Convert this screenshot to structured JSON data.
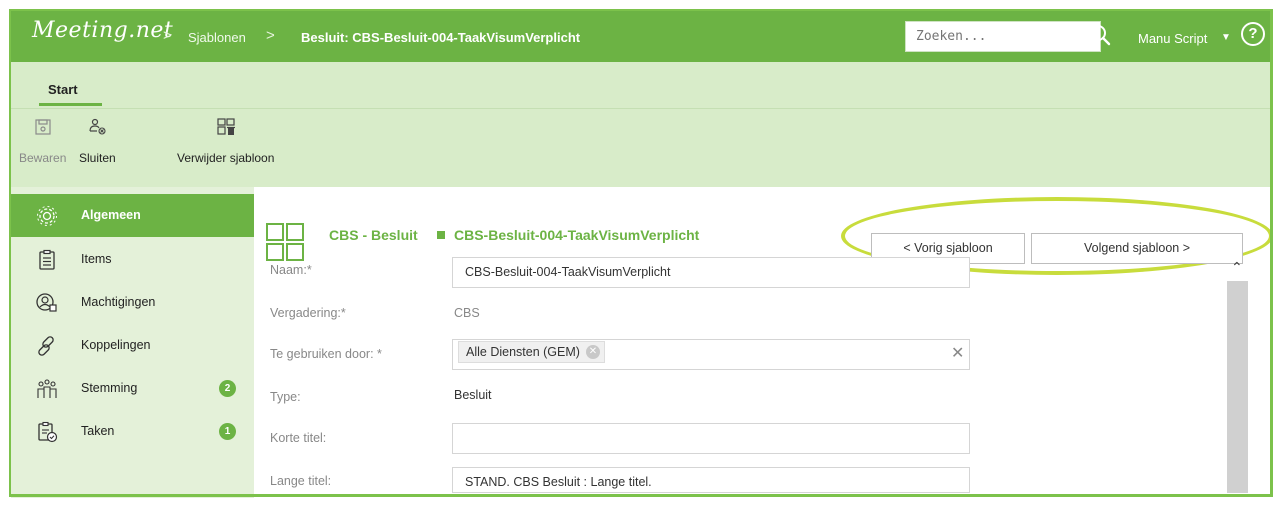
{
  "header": {
    "logo": "Meeting.net",
    "crumb_sep": ">",
    "breadcrumb_1": "Sjablonen",
    "breadcrumb_2": "Besluit: CBS-Besluit-004-TaakVisumVerplicht",
    "search_placeholder": "Zoeken...",
    "user": "Manu Script",
    "user_caret": "▼",
    "help": "?"
  },
  "ribbon": {
    "tab": "Start",
    "buttons": [
      {
        "label": "Bewaren",
        "icon": "save-icon",
        "disabled": true
      },
      {
        "label": "Sluiten",
        "icon": "close-user-icon",
        "disabled": false
      },
      {
        "label": "Verwijder sjabloon",
        "icon": "delete-template-icon",
        "disabled": false
      }
    ]
  },
  "sidebar": {
    "items": [
      {
        "label": "Algemeen",
        "icon": "gear-icon",
        "active": true
      },
      {
        "label": "Items",
        "icon": "clipboard-list-icon"
      },
      {
        "label": "Machtigingen",
        "icon": "users-lock-icon"
      },
      {
        "label": "Koppelingen",
        "icon": "link-icon"
      },
      {
        "label": "Stemming",
        "icon": "voters-icon",
        "badge": "2"
      },
      {
        "label": "Taken",
        "icon": "clipboard-check-icon",
        "badge": "1"
      }
    ]
  },
  "main": {
    "title_type": "CBS - Besluit",
    "title_name": "CBS-Besluit-004-TaakVisumVerplicht",
    "prev_button": "< Vorig sjabloon",
    "next_button": "Volgend sjabloon >",
    "fields": {
      "naam_label": "Naam:*",
      "naam_value": "CBS-Besluit-004-TaakVisumVerplicht",
      "vergadering_label": "Vergadering:*",
      "vergadering_value": "CBS",
      "gebruiken_label": "Te gebruiken door: *",
      "gebruiken_tag": "Alle Diensten (GEM)",
      "type_label": "Type:",
      "type_value": "Besluit",
      "korte_label": "Korte titel:",
      "korte_value": "",
      "lange_label": "Lange titel:",
      "lange_value": "STAND. CBS Besluit : Lange titel."
    }
  },
  "colors": {
    "brand_green": "#6cb344",
    "ribbon_bg": "#d8ecc9",
    "sidebar_bg": "#e4f1d9",
    "highlight_ellipse": "#c8dc3c"
  }
}
